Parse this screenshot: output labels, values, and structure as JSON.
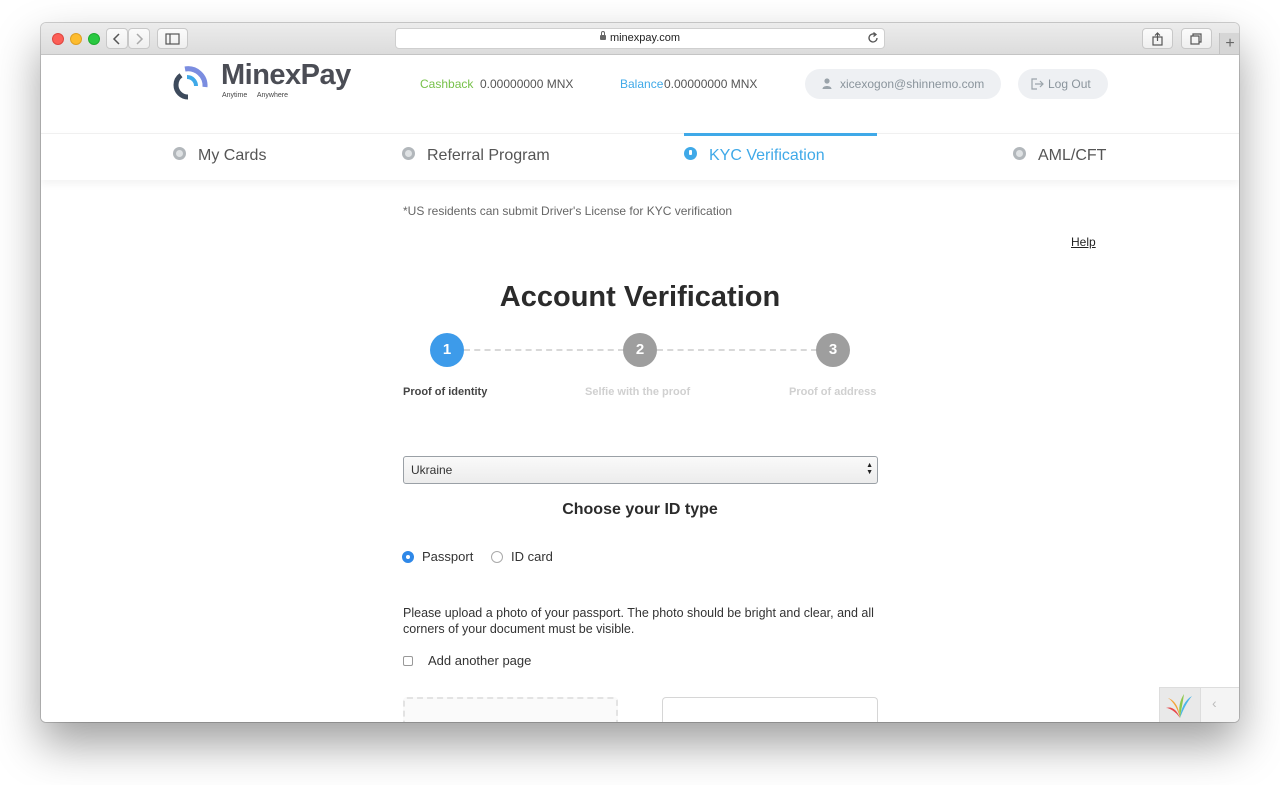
{
  "browser": {
    "url": "minexpay.com"
  },
  "header": {
    "logo_text": "MinexPay",
    "logo_tagline": "Anytime   Anywhere",
    "cashback_label": "Cashback",
    "cashback_value": "0.00000000  MNX",
    "balance_label": "Balance",
    "balance_value": "0.00000000  MNX",
    "user_email": "xicexogon@shinnemo.com",
    "logout_label": "Log Out"
  },
  "tabs": [
    {
      "label": "My Cards"
    },
    {
      "label": "Referral Program"
    },
    {
      "label": "KYC Verification"
    },
    {
      "label": "AML/CFT"
    }
  ],
  "main": {
    "note": "*US residents can submit Driver's License for KYC verification",
    "help_link": "Help",
    "title": "Account Verification",
    "steps": [
      {
        "number": "1",
        "label": "Proof of identity"
      },
      {
        "number": "2",
        "label": "Selfie with the proof"
      },
      {
        "number": "3",
        "label": "Proof of address"
      }
    ],
    "country_selected": "Ukraine",
    "choose_heading": "Choose your ID type",
    "id_types": [
      {
        "label": "Passport"
      },
      {
        "label": "ID card"
      }
    ],
    "upload_instructions": "Please upload a photo of your passport. The photo should be bright and clear, and all corners of your document must be visible.",
    "add_page_label": "Add another page"
  },
  "colors": {
    "accent": "#3fa9e8",
    "cashback": "#77c14a",
    "step_inactive": "#9e9e9e"
  }
}
